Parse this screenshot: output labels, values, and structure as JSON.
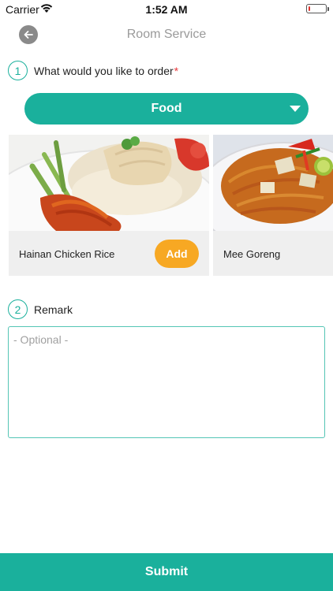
{
  "status_bar": {
    "carrier": "Carrier",
    "time": "1:52 AM",
    "battery_level": 0.1
  },
  "header": {
    "title": "Room Service",
    "back_icon": "arrow-left-icon"
  },
  "order_section": {
    "step_number": "1",
    "label": "What would you like to order",
    "required_mark": "*",
    "category_dropdown": {
      "selected": "Food"
    },
    "items": [
      {
        "name": "Hainan Chicken Rice",
        "add_label": "Add",
        "image": "chicken-rice-photo"
      },
      {
        "name": "Mee Goreng",
        "image": "mee-goreng-photo"
      }
    ]
  },
  "remark_section": {
    "step_number": "2",
    "label": "Remark",
    "placeholder": "- Optional -"
  },
  "submit_label": "Submit",
  "colors": {
    "accent": "#1ab09c",
    "add_button": "#f7a823",
    "required": "#e8383c",
    "battery_low": "#e0332e"
  }
}
